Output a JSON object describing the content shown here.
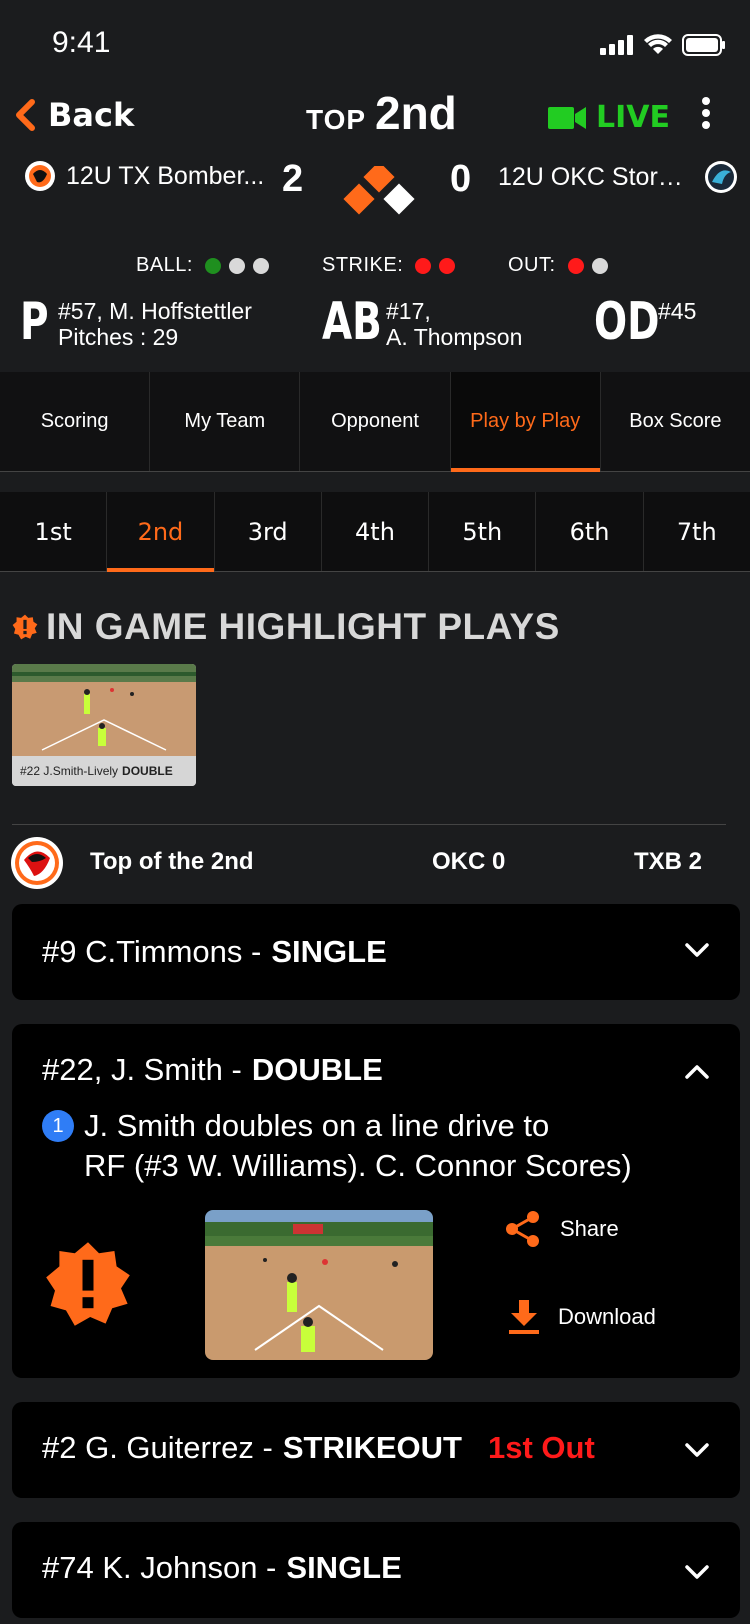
{
  "status": {
    "time": "9:41"
  },
  "header": {
    "back_label": "Back",
    "half": "TOP",
    "inning": "2nd",
    "live_label": "LIVE"
  },
  "score": {
    "home_team": "12U TX Bomber...",
    "home_score": "2",
    "away_score": "0",
    "away_team": "12U OKC Storm..."
  },
  "count": {
    "ball_label": "BALL:",
    "strike_label": "STRIKE:",
    "out_label": "OUT:",
    "balls": 1,
    "strikes": 2,
    "outs": 1,
    "colors": {
      "ball": "#1f8f1f",
      "strike": "#ff1a1a",
      "out": "#ff1a1a",
      "empty": "#d9d9d9"
    }
  },
  "players": {
    "pitcher_letter": "P",
    "pitcher_line1": "#57, M. Hoffstettler",
    "pitcher_line2": "Pitches : 29",
    "batter_letter": "AB",
    "batter_line1": "#17,",
    "batter_line2": "A. Thompson",
    "ondeck_letter": "OD",
    "ondeck_line1": "#45"
  },
  "tabs": [
    "Scoring",
    "My Team",
    "Opponent",
    "Play by Play",
    "Box Score"
  ],
  "active_tab": "Play by Play",
  "innings": [
    "1st",
    "2nd",
    "3rd",
    "4th",
    "5th",
    "6th",
    "7th"
  ],
  "active_inning": "2nd",
  "highlights": {
    "title": "IN GAME HIGHLIGHT PLAYS",
    "items": [
      {
        "player": "#22 J.Smith-Lively",
        "play": "DOUBLE"
      }
    ]
  },
  "summary": {
    "title": "Top of the 2nd",
    "okc": "OKC 0",
    "txb": "TXB 2"
  },
  "plays": [
    {
      "player": "#9 C.Timmons - ",
      "result": "SINGLE",
      "out": "",
      "expanded": false
    },
    {
      "player": "#22, J. Smith - ",
      "result": "DOUBLE",
      "out": "",
      "expanded": true,
      "detail_num": "1",
      "detail_line1": "J. Smith doubles on a line drive to",
      "detail_line2": "RF (#3 W. Williams). C. Connor Scores)",
      "share_label": "Share",
      "download_label": "Download"
    },
    {
      "player": "#2 G. Guiterrez - ",
      "result": "STRIKEOUT",
      "out": "1st Out",
      "expanded": false
    },
    {
      "player": "#74 K. Johnson - ",
      "result": "SINGLE",
      "out": "",
      "expanded": false
    }
  ],
  "accent": "#ff6a1a",
  "live_color": "#22cc22"
}
